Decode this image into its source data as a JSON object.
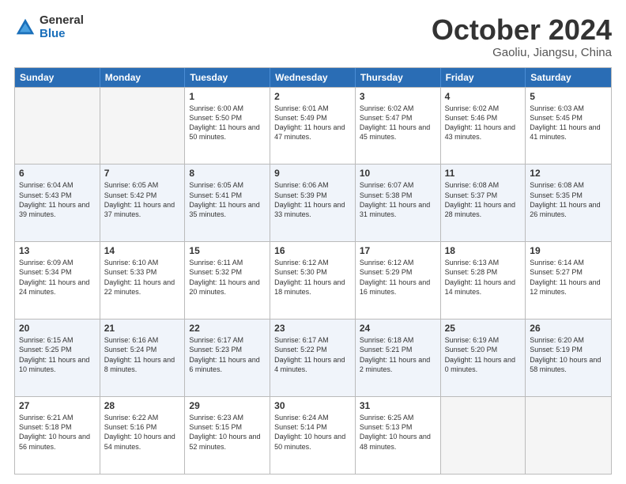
{
  "header": {
    "logo_general": "General",
    "logo_blue": "Blue",
    "month_title": "October 2024",
    "location": "Gaoliu, Jiangsu, China"
  },
  "calendar": {
    "days_of_week": [
      "Sunday",
      "Monday",
      "Tuesday",
      "Wednesday",
      "Thursday",
      "Friday",
      "Saturday"
    ],
    "weeks": [
      [
        {
          "day": "",
          "empty": true
        },
        {
          "day": "",
          "empty": true
        },
        {
          "day": "1",
          "sunrise": "Sunrise: 6:00 AM",
          "sunset": "Sunset: 5:50 PM",
          "daylight": "Daylight: 11 hours and 50 minutes."
        },
        {
          "day": "2",
          "sunrise": "Sunrise: 6:01 AM",
          "sunset": "Sunset: 5:49 PM",
          "daylight": "Daylight: 11 hours and 47 minutes."
        },
        {
          "day": "3",
          "sunrise": "Sunrise: 6:02 AM",
          "sunset": "Sunset: 5:47 PM",
          "daylight": "Daylight: 11 hours and 45 minutes."
        },
        {
          "day": "4",
          "sunrise": "Sunrise: 6:02 AM",
          "sunset": "Sunset: 5:46 PM",
          "daylight": "Daylight: 11 hours and 43 minutes."
        },
        {
          "day": "5",
          "sunrise": "Sunrise: 6:03 AM",
          "sunset": "Sunset: 5:45 PM",
          "daylight": "Daylight: 11 hours and 41 minutes."
        }
      ],
      [
        {
          "day": "6",
          "sunrise": "Sunrise: 6:04 AM",
          "sunset": "Sunset: 5:43 PM",
          "daylight": "Daylight: 11 hours and 39 minutes."
        },
        {
          "day": "7",
          "sunrise": "Sunrise: 6:05 AM",
          "sunset": "Sunset: 5:42 PM",
          "daylight": "Daylight: 11 hours and 37 minutes."
        },
        {
          "day": "8",
          "sunrise": "Sunrise: 6:05 AM",
          "sunset": "Sunset: 5:41 PM",
          "daylight": "Daylight: 11 hours and 35 minutes."
        },
        {
          "day": "9",
          "sunrise": "Sunrise: 6:06 AM",
          "sunset": "Sunset: 5:39 PM",
          "daylight": "Daylight: 11 hours and 33 minutes."
        },
        {
          "day": "10",
          "sunrise": "Sunrise: 6:07 AM",
          "sunset": "Sunset: 5:38 PM",
          "daylight": "Daylight: 11 hours and 31 minutes."
        },
        {
          "day": "11",
          "sunrise": "Sunrise: 6:08 AM",
          "sunset": "Sunset: 5:37 PM",
          "daylight": "Daylight: 11 hours and 28 minutes."
        },
        {
          "day": "12",
          "sunrise": "Sunrise: 6:08 AM",
          "sunset": "Sunset: 5:35 PM",
          "daylight": "Daylight: 11 hours and 26 minutes."
        }
      ],
      [
        {
          "day": "13",
          "sunrise": "Sunrise: 6:09 AM",
          "sunset": "Sunset: 5:34 PM",
          "daylight": "Daylight: 11 hours and 24 minutes."
        },
        {
          "day": "14",
          "sunrise": "Sunrise: 6:10 AM",
          "sunset": "Sunset: 5:33 PM",
          "daylight": "Daylight: 11 hours and 22 minutes."
        },
        {
          "day": "15",
          "sunrise": "Sunrise: 6:11 AM",
          "sunset": "Sunset: 5:32 PM",
          "daylight": "Daylight: 11 hours and 20 minutes."
        },
        {
          "day": "16",
          "sunrise": "Sunrise: 6:12 AM",
          "sunset": "Sunset: 5:30 PM",
          "daylight": "Daylight: 11 hours and 18 minutes."
        },
        {
          "day": "17",
          "sunrise": "Sunrise: 6:12 AM",
          "sunset": "Sunset: 5:29 PM",
          "daylight": "Daylight: 11 hours and 16 minutes."
        },
        {
          "day": "18",
          "sunrise": "Sunrise: 6:13 AM",
          "sunset": "Sunset: 5:28 PM",
          "daylight": "Daylight: 11 hours and 14 minutes."
        },
        {
          "day": "19",
          "sunrise": "Sunrise: 6:14 AM",
          "sunset": "Sunset: 5:27 PM",
          "daylight": "Daylight: 11 hours and 12 minutes."
        }
      ],
      [
        {
          "day": "20",
          "sunrise": "Sunrise: 6:15 AM",
          "sunset": "Sunset: 5:25 PM",
          "daylight": "Daylight: 11 hours and 10 minutes."
        },
        {
          "day": "21",
          "sunrise": "Sunrise: 6:16 AM",
          "sunset": "Sunset: 5:24 PM",
          "daylight": "Daylight: 11 hours and 8 minutes."
        },
        {
          "day": "22",
          "sunrise": "Sunrise: 6:17 AM",
          "sunset": "Sunset: 5:23 PM",
          "daylight": "Daylight: 11 hours and 6 minutes."
        },
        {
          "day": "23",
          "sunrise": "Sunrise: 6:17 AM",
          "sunset": "Sunset: 5:22 PM",
          "daylight": "Daylight: 11 hours and 4 minutes."
        },
        {
          "day": "24",
          "sunrise": "Sunrise: 6:18 AM",
          "sunset": "Sunset: 5:21 PM",
          "daylight": "Daylight: 11 hours and 2 minutes."
        },
        {
          "day": "25",
          "sunrise": "Sunrise: 6:19 AM",
          "sunset": "Sunset: 5:20 PM",
          "daylight": "Daylight: 11 hours and 0 minutes."
        },
        {
          "day": "26",
          "sunrise": "Sunrise: 6:20 AM",
          "sunset": "Sunset: 5:19 PM",
          "daylight": "Daylight: 10 hours and 58 minutes."
        }
      ],
      [
        {
          "day": "27",
          "sunrise": "Sunrise: 6:21 AM",
          "sunset": "Sunset: 5:18 PM",
          "daylight": "Daylight: 10 hours and 56 minutes."
        },
        {
          "day": "28",
          "sunrise": "Sunrise: 6:22 AM",
          "sunset": "Sunset: 5:16 PM",
          "daylight": "Daylight: 10 hours and 54 minutes."
        },
        {
          "day": "29",
          "sunrise": "Sunrise: 6:23 AM",
          "sunset": "Sunset: 5:15 PM",
          "daylight": "Daylight: 10 hours and 52 minutes."
        },
        {
          "day": "30",
          "sunrise": "Sunrise: 6:24 AM",
          "sunset": "Sunset: 5:14 PM",
          "daylight": "Daylight: 10 hours and 50 minutes."
        },
        {
          "day": "31",
          "sunrise": "Sunrise: 6:25 AM",
          "sunset": "Sunset: 5:13 PM",
          "daylight": "Daylight: 10 hours and 48 minutes."
        },
        {
          "day": "",
          "empty": true
        },
        {
          "day": "",
          "empty": true
        }
      ]
    ]
  }
}
